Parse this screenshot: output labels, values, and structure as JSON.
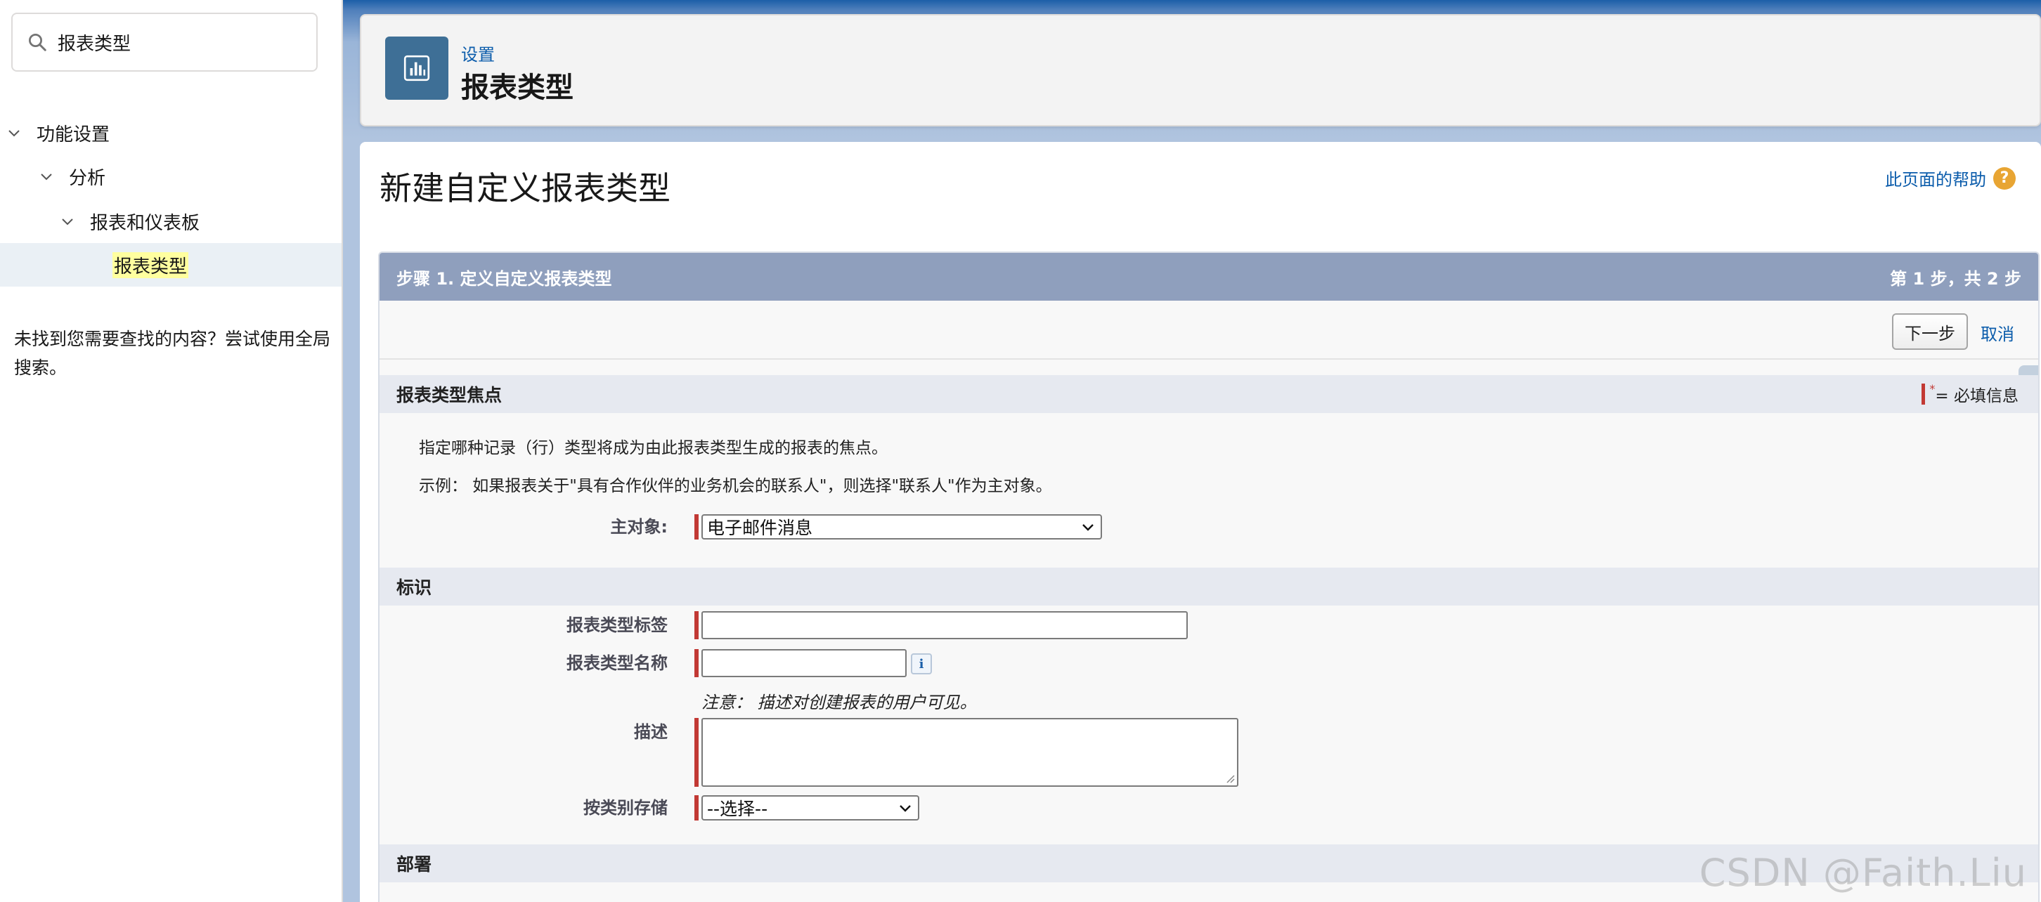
{
  "sidebar": {
    "search": {
      "value": "报表类型",
      "placeholder": ""
    },
    "tree": [
      {
        "label": "功能设置",
        "level": 0,
        "expanded": true
      },
      {
        "label": "分析",
        "level": 1,
        "expanded": true
      },
      {
        "label": "报表和仪表板",
        "level": 2,
        "expanded": true
      },
      {
        "label": "报表类型",
        "level": 3,
        "selected": true
      }
    ],
    "not_found_text": "未找到您需要查找的内容？尝试使用全局搜索。"
  },
  "header": {
    "breadcrumb": "设置",
    "title": "报表类型",
    "icon": "report-chart-icon"
  },
  "page": {
    "title": "新建自定义报表类型",
    "help_link": "此页面的帮助",
    "help_icon": "question-icon"
  },
  "wizard": {
    "step_title": "步骤 1. 定义自定义报表类型",
    "step_counter": "第 1 步，共 2 步",
    "next_button": "下一步",
    "cancel_link": "取消"
  },
  "sections": {
    "focus": {
      "title": "报表类型焦点",
      "required_legend": "= 必填信息",
      "description": "指定哪种记录（行）类型将成为由此报表类型生成的报表的焦点。",
      "example": "示例：  如果报表关于\"具有合作伙伴的业务机会的联系人\"，则选择\"联系人\"作为主对象。",
      "primary_object_label": "主对象:",
      "primary_object_value": "电子邮件消息"
    },
    "identification": {
      "title": "标识",
      "label_field": "报表类型标签",
      "name_field": "报表类型名称",
      "note": "注意：  描述对创建报表的用户可见。",
      "description_field": "描述",
      "category_field": "按类别存储",
      "category_value": "--选择--"
    },
    "deployment": {
      "title": "部署"
    }
  },
  "watermark": "CSDN @Faith.Liu",
  "colors": {
    "accent_link": "#0b5cab",
    "step_header": "#8f9fbd",
    "required": "#c23934",
    "selected_highlight": "#ffff9f"
  }
}
